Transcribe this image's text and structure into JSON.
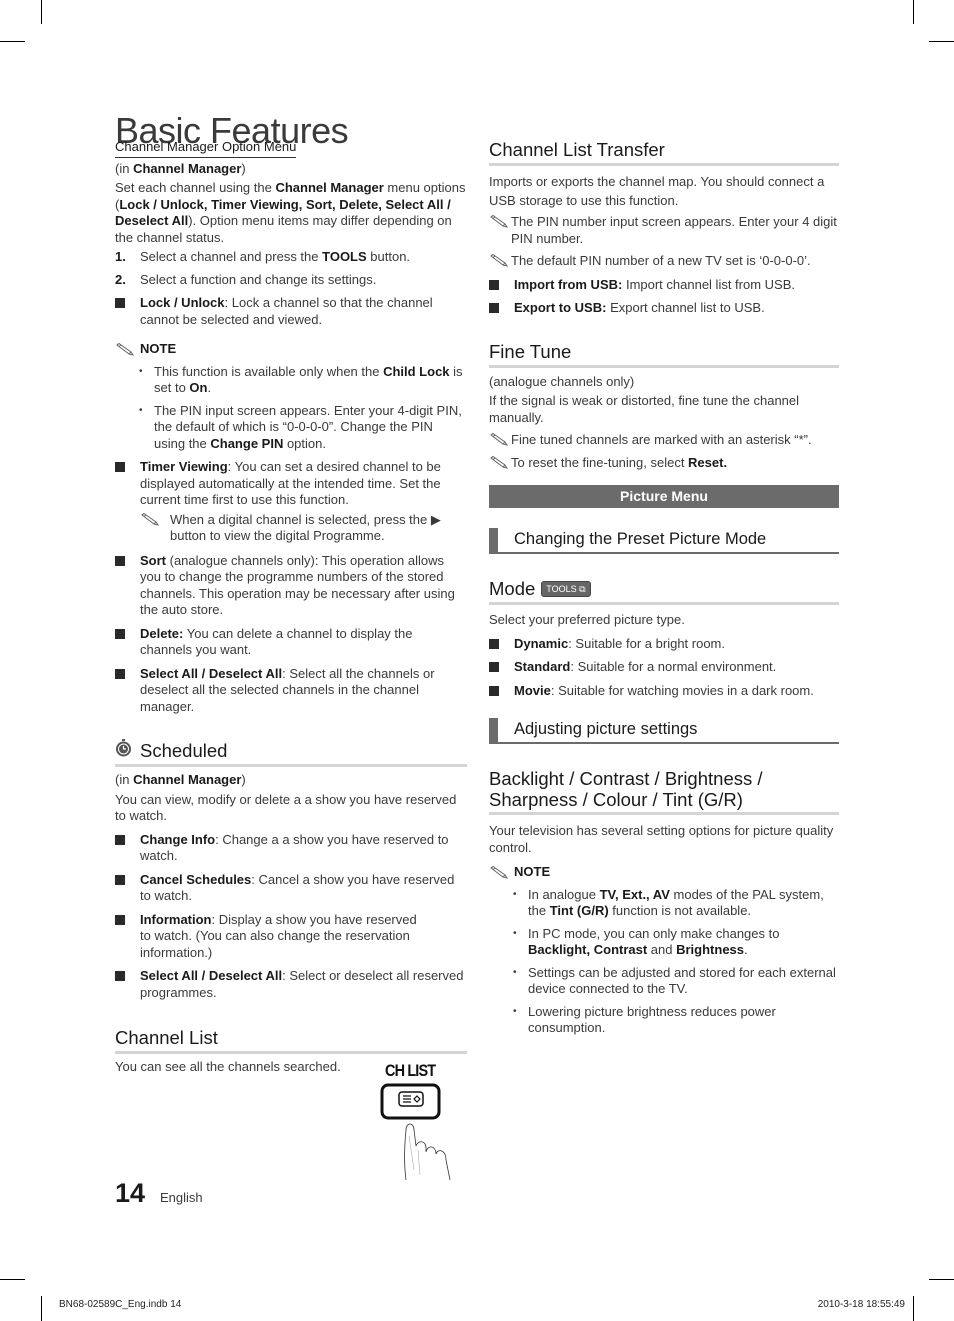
{
  "page": {
    "title": "Basic Features",
    "page_number": "14",
    "language": "English",
    "slug_left": "BN68-02589C_Eng.indb   14",
    "slug_right": "2010-3-18   18:55:49"
  },
  "left": {
    "option_menu": {
      "heading": "Channel Manager Option Menu",
      "context_pre": "(in ",
      "context_bold": "Channel Manager",
      "context_post": ")",
      "intro_1": "Set each channel using the ",
      "intro_b1": "Channel Manager",
      "intro_2": " menu options (",
      "intro_b2": "Lock / Unlock, Timer Viewing, Sort, Delete, Select All / Deselect All",
      "intro_3": "). Option menu items may differ depending on the channel status.",
      "steps": [
        {
          "num": "1.",
          "pre": "Select a channel and press the ",
          "bold": "TOOLS",
          "post": " button."
        },
        {
          "num": "2.",
          "pre": "Select a function and change its settings.",
          "bold": "",
          "post": ""
        }
      ],
      "lock": {
        "bold": "Lock / Unlock",
        "text": ": Lock a channel so that the channel cannot be selected and viewed."
      },
      "note_label": "NOTE",
      "note_bullets": [
        {
          "pre": "This function is available only when the ",
          "b1": "Child Lock",
          "mid": " is set to ",
          "b2": "On",
          "post": "."
        },
        {
          "pre": "The PIN input screen appears. Enter your 4-digit PIN, the default of which is “0-0-0-0”. Change the PIN using the ",
          "b1": "Change PIN",
          "mid": " option.",
          "b2": "",
          "post": ""
        }
      ],
      "timer": {
        "bold": "Timer Viewing",
        "text": ": You can set a desired channel to be displayed automatically at the intended time. Set the current time first to use this function."
      },
      "timer_note": "When a digital channel is selected, press the ▶ button to view the digital Programme.",
      "sort": {
        "bold": "Sort",
        "text": " (analogue channels only): This operation allows you to change the programme numbers of the stored channels. This operation may be necessary after using the auto store."
      },
      "delete": {
        "bold": "Delete:",
        "text": " You can delete a channel to display the channels you want."
      },
      "select_all": {
        "bold": "Select All / Deselect All",
        "text": ": Select all the channels or deselect all the selected channels in the channel manager."
      }
    },
    "scheduled": {
      "heading": "Scheduled",
      "icon": "stopwatch-icon",
      "context_pre": "(in ",
      "context_bold": "Channel Manager",
      "context_post": ")",
      "intro": "You can view, modify or delete a a show you have reserved to watch.",
      "items": [
        {
          "bold": "Change Info",
          "text": ": Change a a show you have reserved to watch."
        },
        {
          "bold": "Cancel Schedules",
          "text": ": Cancel a show you have reserved to watch."
        },
        {
          "bold": "Information",
          "text": ": Display a show you have reserved to watch. (You can also change the reservation information.)"
        },
        {
          "bold": "Select All / Deselect All",
          "text": ": Select or deselect all reserved programmes."
        }
      ]
    },
    "channel_list": {
      "heading": "Channel List",
      "text": "You can see all the channels searched.",
      "button_label": "CH LIST",
      "icon": "remote-button-press-icon"
    }
  },
  "right": {
    "transfer": {
      "heading": "Channel List Transfer",
      "intro": "Imports or exports the channel map. You should connect a USB storage to use this function.",
      "notes": [
        "The PIN number input screen appears. Enter your 4 digit PIN number.",
        "The default PIN number of a new TV set is ‘0-0-0-0’."
      ],
      "items": [
        {
          "bold": "Import from USB:",
          "text": " Import channel list from USB."
        },
        {
          "bold": "Export to USB:",
          "text": " Export channel list to USB."
        }
      ]
    },
    "fine_tune": {
      "heading": "Fine Tune",
      "context": "(analogue channels only)",
      "intro": "If the signal is weak or distorted, fine tune the channel manually.",
      "note_1": "Fine tuned channels are marked with an asterisk “*”.",
      "note_2_pre": "To reset the fine-tuning, select ",
      "note_2_bold": "Reset."
    },
    "picture_menu": {
      "label": "Picture Menu"
    },
    "preset": {
      "heading": "Changing the Preset Picture Mode"
    },
    "mode": {
      "heading": "Mode",
      "badge": "TOOLS",
      "intro": "Select your preferred picture type.",
      "items": [
        {
          "bold": "Dynamic",
          "text": ": Suitable for a bright room."
        },
        {
          "bold": "Standard",
          "text": ": Suitable for a normal environment."
        },
        {
          "bold": "Movie",
          "text": ": Suitable for watching movies in a dark room."
        }
      ]
    },
    "adjusting": {
      "heading": "Adjusting picture settings"
    },
    "backlight": {
      "heading_1": "Backlight / Contrast / Brightness /",
      "heading_2": "Sharpness / Colour / Tint (G/R)",
      "intro": "Your television has several setting options for picture quality control.",
      "note_label": "NOTE",
      "b1_pre": "In analogue ",
      "b1_b1": "TV, Ext., AV",
      "b1_mid": " modes of the PAL system, the ",
      "b1_b2": "Tint (G/R)",
      "b1_post": " function is not available.",
      "b2_pre": "In PC mode, you can only make changes to ",
      "b2_b1": "Backlight, Contrast",
      "b2_mid": " and ",
      "b2_b2": "Brightness",
      "b2_post": ".",
      "b3": "Settings can be adjusted and stored for each external device connected to the TV.",
      "b4": "Lowering picture brightness reduces power consumption."
    }
  }
}
